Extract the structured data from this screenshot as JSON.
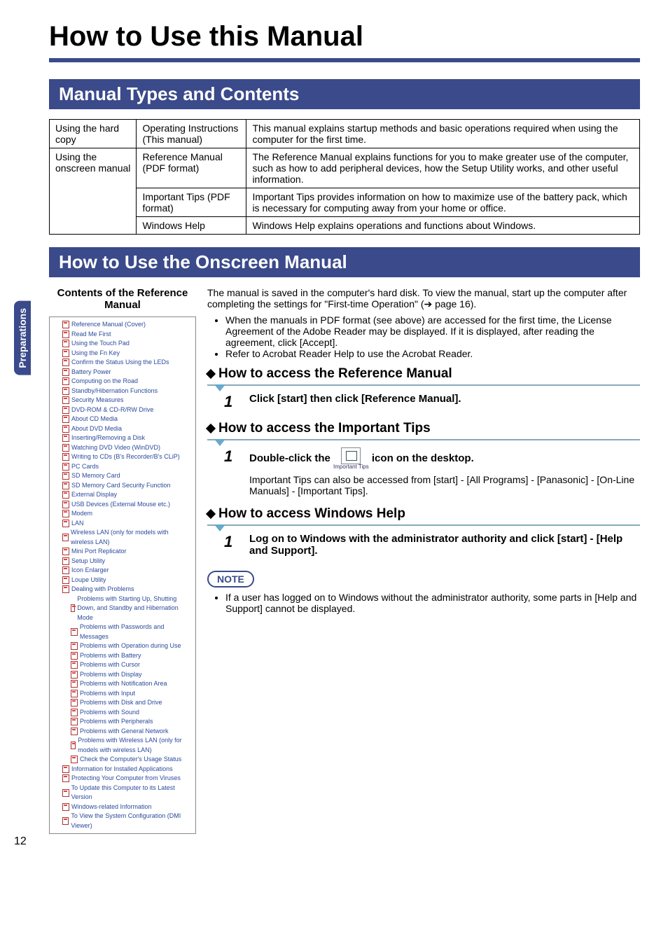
{
  "page_title": "How to Use this Manual",
  "sidebar_tab": "Preparations",
  "section1": "Manual Types and Contents",
  "section2": "How to Use the Onscreen Manual",
  "table": {
    "r1c1": "Using the hard copy",
    "r1c2": "Operating Instructions (This manual)",
    "r1c3": "This manual explains startup methods and basic operations required when using the computer for the first time.",
    "r2c1": "Using the onscreen manual",
    "r2c2": "Reference Manual (PDF format)",
    "r2c3": "The Reference Manual explains functions for you to make greater use of the computer, such as how to add peripheral devices, how the Setup Utility works, and other useful information.",
    "r3c2": "Important Tips (PDF format)",
    "r3c3": "Important Tips provides information on how to maximize use of the battery pack, which is necessary for computing away from your home or office.",
    "r4c2": "Windows Help",
    "r4c3": "Windows Help explains operations and functions about Windows."
  },
  "contents_title": "Contents of the Reference Manual",
  "toc": [
    "Reference Manual (Cover)",
    "Read Me First",
    "Using the Touch Pad",
    "Using the Fn Key",
    "Confirm the Status Using the LEDs",
    "Battery Power",
    "Computing on the Road",
    "Standby/Hibernation Functions",
    "Security Measures",
    "DVD-ROM & CD-R/RW Drive",
    "About CD Media",
    "About DVD Media",
    "Inserting/Removing a Disk",
    "Watching DVD Video (WinDVD)",
    "Writing to CDs (B's Recorder/B's CLiP)",
    "PC Cards",
    "SD Memory Card",
    "SD Memory Card Security Function",
    "External Display",
    "USB Devices (External Mouse etc.)",
    "Modem",
    "LAN",
    "Wireless LAN (only for models with wireless LAN)",
    "Mini Port Replicator",
    "Setup Utility",
    "Icon Enlarger",
    "Loupe Utility"
  ],
  "toc_problems_header": "Dealing with Problems",
  "toc_problems": [
    "Problems with Starting Up, Shutting Down, and Standby and Hibernation Mode",
    "Problems with Passwords and Messages",
    "Problems with Operation during Use",
    "Problems with Battery",
    "Problems with Cursor",
    "Problems with Display",
    "Problems with Notification Area",
    "Problems with Input",
    "Problems with Disk and Drive",
    "Problems with Sound",
    "Problems with Peripherals",
    "Problems with General Network",
    "Problems with Wireless LAN (only for models with wireless LAN)",
    "Check the Computer's Usage Status"
  ],
  "toc_tail": [
    "Information for Installed Applications",
    "Protecting Your Computer from Viruses",
    "To Update this Computer to its Latest Version",
    "Windows-related Information",
    "To View the System Configuration (DMI Viewer)"
  ],
  "intro1": "The manual is saved in the computer's hard disk.  To view the manual, start up the computer after completing the settings for \"First-time Operation\" (➔ page 16).",
  "bullets": [
    "When the manuals in PDF format (see above) are accessed for the first time, the License Agreement of the Adobe Reader may be displayed. If it is displayed, after reading the agreement, click [Accept].",
    "Refer to Acrobat Reader Help to use the Acrobat Reader."
  ],
  "sub1": "How to access the Reference Manual",
  "step1": {
    "num": "1",
    "text": "Click [start] then click [Reference Manual]."
  },
  "sub2": "How to access the Important Tips",
  "step2": {
    "num": "1",
    "text_a": "Double-click the",
    "icon_label": "Important Tips",
    "text_b": "icon on the desktop.",
    "sub": "Important Tips can also be accessed from [start] - [All Programs] - [Panasonic] - [On-Line Manuals] - [Important Tips]."
  },
  "sub3": "How to access Windows Help",
  "step3": {
    "num": "1",
    "text": "Log on to Windows with the administrator authority and click [start] - [Help and Support]."
  },
  "note_label": "NOTE",
  "note_text": "If a user has logged on to Windows without the administrator authority, some parts in [Help and Support] cannot be displayed.",
  "page_num": "12"
}
